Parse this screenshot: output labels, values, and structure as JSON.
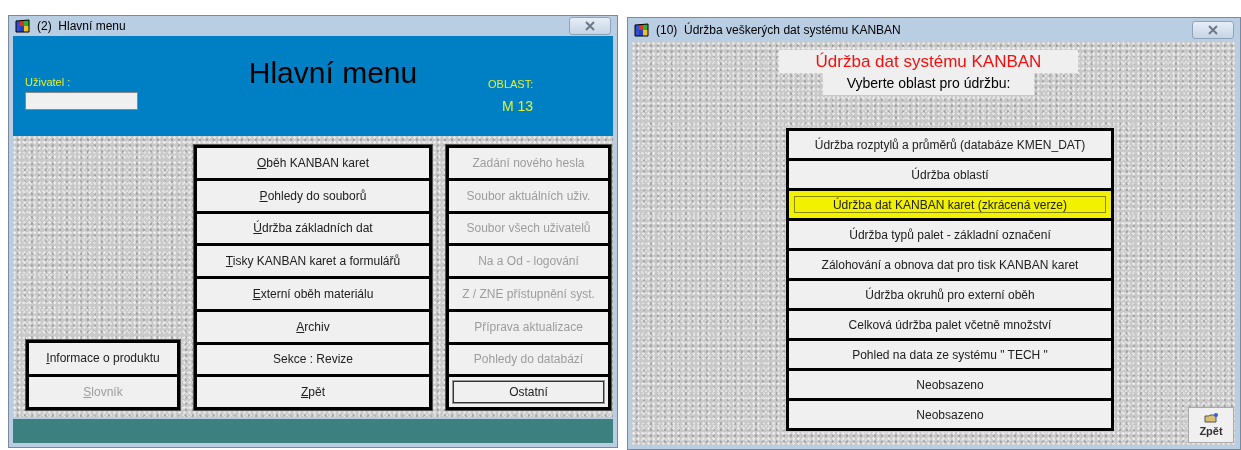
{
  "main_window": {
    "title": "(2)  Hlavní menu",
    "user_label": "Uživatel :",
    "heading": "Hlavní menu",
    "area_label": "OBLAST:",
    "area_value": "M 13",
    "info_buttons": [
      {
        "label": "Informace o produktu",
        "disabled": false,
        "accelerator": true
      },
      {
        "label": "Slovník",
        "disabled": true,
        "accelerator": true
      }
    ],
    "menu_buttons": [
      {
        "label": "Oběh KANBAN karet",
        "disabled": false,
        "accelerator": true
      },
      {
        "label": "Pohledy do souborů",
        "disabled": false,
        "accelerator": true
      },
      {
        "label": "Údržba základních dat",
        "disabled": false,
        "accelerator": true
      },
      {
        "label": "Tisky KANBAN karet a formulářů",
        "disabled": false,
        "accelerator": true
      },
      {
        "label": "Externí oběh materiálu",
        "disabled": false,
        "accelerator": true
      },
      {
        "label": "Archiv",
        "disabled": false,
        "accelerator": true
      },
      {
        "label": "Sekce : Revize",
        "disabled": false,
        "accelerator": false
      },
      {
        "label": "Zpět",
        "disabled": false,
        "accelerator": true
      }
    ],
    "admin_buttons": [
      {
        "label": "Zadání nového hesla",
        "disabled": true,
        "focused": false
      },
      {
        "label": "Soubor aktuálních uživ.",
        "disabled": true,
        "focused": false
      },
      {
        "label": "Soubor všech uživatelů",
        "disabled": true,
        "focused": false
      },
      {
        "label": "Na a Od - logování",
        "disabled": true,
        "focused": false
      },
      {
        "label": "Z / ZNE přístupnění syst.",
        "disabled": true,
        "focused": false
      },
      {
        "label": "Příprava aktualizace",
        "disabled": true,
        "focused": false
      },
      {
        "label": "Pohledy do databází",
        "disabled": true,
        "focused": false
      },
      {
        "label": "Ostatní",
        "disabled": false,
        "focused": true
      }
    ]
  },
  "maintenance_window": {
    "title": "(10)  Údržba veškerých dat systému KANBAN",
    "heading": "Údržba dat systému KANBAN",
    "prompt": "Vyberte oblast pro údržbu:",
    "options": [
      {
        "label": "Údržba rozptylů a průměrů (databáze KMEN_DAT)",
        "highlighted": false
      },
      {
        "label": "Údržba oblastí",
        "highlighted": false
      },
      {
        "label": "Údržba dat KANBAN karet (zkrácená verze)",
        "highlighted": true
      },
      {
        "label": "Údržba typů palet - základní označení",
        "highlighted": false
      },
      {
        "label": "Zálohování a obnova dat pro tisk KANBAN karet",
        "highlighted": false
      },
      {
        "label": "Údržba okruhů pro externí oběh",
        "highlighted": false
      },
      {
        "label": "Celková údržba palet včetně množství",
        "highlighted": false
      },
      {
        "label": "Pohled na data ze systému \" TECH \"",
        "highlighted": false
      },
      {
        "label": "Neobsazeno",
        "highlighted": false
      },
      {
        "label": "Neobsazeno",
        "highlighted": false
      }
    ],
    "back_button": {
      "label": "Zpět"
    }
  }
}
